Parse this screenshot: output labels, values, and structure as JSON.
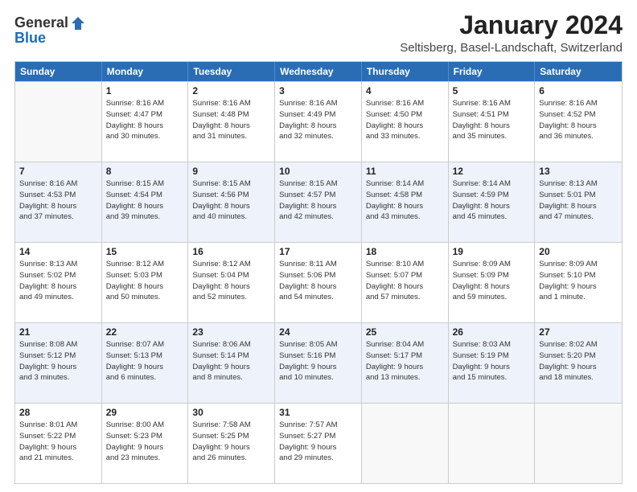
{
  "logo": {
    "general": "General",
    "blue": "Blue"
  },
  "title": "January 2024",
  "subtitle": "Seltisberg, Basel-Landschaft, Switzerland",
  "calendar": {
    "headers": [
      "Sunday",
      "Monday",
      "Tuesday",
      "Wednesday",
      "Thursday",
      "Friday",
      "Saturday"
    ],
    "weeks": [
      [
        {
          "day": "",
          "info": ""
        },
        {
          "day": "1",
          "info": "Sunrise: 8:16 AM\nSunset: 4:47 PM\nDaylight: 8 hours\nand 30 minutes."
        },
        {
          "day": "2",
          "info": "Sunrise: 8:16 AM\nSunset: 4:48 PM\nDaylight: 8 hours\nand 31 minutes."
        },
        {
          "day": "3",
          "info": "Sunrise: 8:16 AM\nSunset: 4:49 PM\nDaylight: 8 hours\nand 32 minutes."
        },
        {
          "day": "4",
          "info": "Sunrise: 8:16 AM\nSunset: 4:50 PM\nDaylight: 8 hours\nand 33 minutes."
        },
        {
          "day": "5",
          "info": "Sunrise: 8:16 AM\nSunset: 4:51 PM\nDaylight: 8 hours\nand 35 minutes."
        },
        {
          "day": "6",
          "info": "Sunrise: 8:16 AM\nSunset: 4:52 PM\nDaylight: 8 hours\nand 36 minutes."
        }
      ],
      [
        {
          "day": "7",
          "info": "Sunrise: 8:16 AM\nSunset: 4:53 PM\nDaylight: 8 hours\nand 37 minutes."
        },
        {
          "day": "8",
          "info": "Sunrise: 8:15 AM\nSunset: 4:54 PM\nDaylight: 8 hours\nand 39 minutes."
        },
        {
          "day": "9",
          "info": "Sunrise: 8:15 AM\nSunset: 4:56 PM\nDaylight: 8 hours\nand 40 minutes."
        },
        {
          "day": "10",
          "info": "Sunrise: 8:15 AM\nSunset: 4:57 PM\nDaylight: 8 hours\nand 42 minutes."
        },
        {
          "day": "11",
          "info": "Sunrise: 8:14 AM\nSunset: 4:58 PM\nDaylight: 8 hours\nand 43 minutes."
        },
        {
          "day": "12",
          "info": "Sunrise: 8:14 AM\nSunset: 4:59 PM\nDaylight: 8 hours\nand 45 minutes."
        },
        {
          "day": "13",
          "info": "Sunrise: 8:13 AM\nSunset: 5:01 PM\nDaylight: 8 hours\nand 47 minutes."
        }
      ],
      [
        {
          "day": "14",
          "info": "Sunrise: 8:13 AM\nSunset: 5:02 PM\nDaylight: 8 hours\nand 49 minutes."
        },
        {
          "day": "15",
          "info": "Sunrise: 8:12 AM\nSunset: 5:03 PM\nDaylight: 8 hours\nand 50 minutes."
        },
        {
          "day": "16",
          "info": "Sunrise: 8:12 AM\nSunset: 5:04 PM\nDaylight: 8 hours\nand 52 minutes."
        },
        {
          "day": "17",
          "info": "Sunrise: 8:11 AM\nSunset: 5:06 PM\nDaylight: 8 hours\nand 54 minutes."
        },
        {
          "day": "18",
          "info": "Sunrise: 8:10 AM\nSunset: 5:07 PM\nDaylight: 8 hours\nand 57 minutes."
        },
        {
          "day": "19",
          "info": "Sunrise: 8:09 AM\nSunset: 5:09 PM\nDaylight: 8 hours\nand 59 minutes."
        },
        {
          "day": "20",
          "info": "Sunrise: 8:09 AM\nSunset: 5:10 PM\nDaylight: 9 hours\nand 1 minute."
        }
      ],
      [
        {
          "day": "21",
          "info": "Sunrise: 8:08 AM\nSunset: 5:12 PM\nDaylight: 9 hours\nand 3 minutes."
        },
        {
          "day": "22",
          "info": "Sunrise: 8:07 AM\nSunset: 5:13 PM\nDaylight: 9 hours\nand 6 minutes."
        },
        {
          "day": "23",
          "info": "Sunrise: 8:06 AM\nSunset: 5:14 PM\nDaylight: 9 hours\nand 8 minutes."
        },
        {
          "day": "24",
          "info": "Sunrise: 8:05 AM\nSunset: 5:16 PM\nDaylight: 9 hours\nand 10 minutes."
        },
        {
          "day": "25",
          "info": "Sunrise: 8:04 AM\nSunset: 5:17 PM\nDaylight: 9 hours\nand 13 minutes."
        },
        {
          "day": "26",
          "info": "Sunrise: 8:03 AM\nSunset: 5:19 PM\nDaylight: 9 hours\nand 15 minutes."
        },
        {
          "day": "27",
          "info": "Sunrise: 8:02 AM\nSunset: 5:20 PM\nDaylight: 9 hours\nand 18 minutes."
        }
      ],
      [
        {
          "day": "28",
          "info": "Sunrise: 8:01 AM\nSunset: 5:22 PM\nDaylight: 9 hours\nand 21 minutes."
        },
        {
          "day": "29",
          "info": "Sunrise: 8:00 AM\nSunset: 5:23 PM\nDaylight: 9 hours\nand 23 minutes."
        },
        {
          "day": "30",
          "info": "Sunrise: 7:58 AM\nSunset: 5:25 PM\nDaylight: 9 hours\nand 26 minutes."
        },
        {
          "day": "31",
          "info": "Sunrise: 7:57 AM\nSunset: 5:27 PM\nDaylight: 9 hours\nand 29 minutes."
        },
        {
          "day": "",
          "info": ""
        },
        {
          "day": "",
          "info": ""
        },
        {
          "day": "",
          "info": ""
        }
      ]
    ]
  }
}
